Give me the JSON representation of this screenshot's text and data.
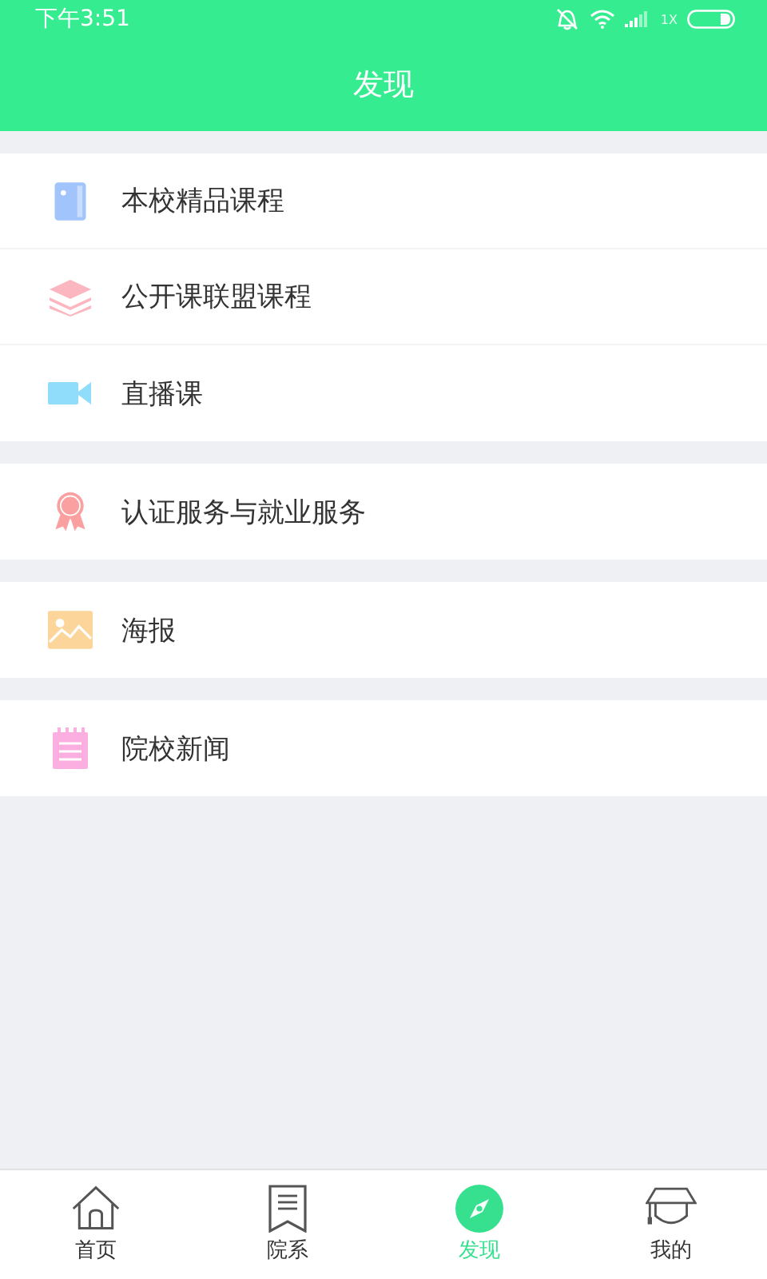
{
  "status_bar": {
    "time": "下午3:51",
    "network": "1X"
  },
  "header": {
    "title": "发现"
  },
  "groups": [
    {
      "items": [
        {
          "label": "本校精品课程",
          "kind": "book"
        },
        {
          "label": "公开课联盟课程",
          "kind": "layers"
        },
        {
          "label": "直播课",
          "kind": "video"
        }
      ]
    },
    {
      "items": [
        {
          "label": "认证服务与就业服务",
          "kind": "award"
        }
      ]
    },
    {
      "items": [
        {
          "label": "海报",
          "kind": "image"
        }
      ]
    },
    {
      "items": [
        {
          "label": "院校新闻",
          "kind": "notepad"
        }
      ]
    }
  ],
  "tabs": [
    {
      "label": "首页",
      "kind": "home",
      "selected": false
    },
    {
      "label": "院系",
      "kind": "list",
      "selected": false
    },
    {
      "label": "发现",
      "kind": "compass",
      "selected": true
    },
    {
      "label": "我的",
      "kind": "cap",
      "selected": false
    }
  ]
}
